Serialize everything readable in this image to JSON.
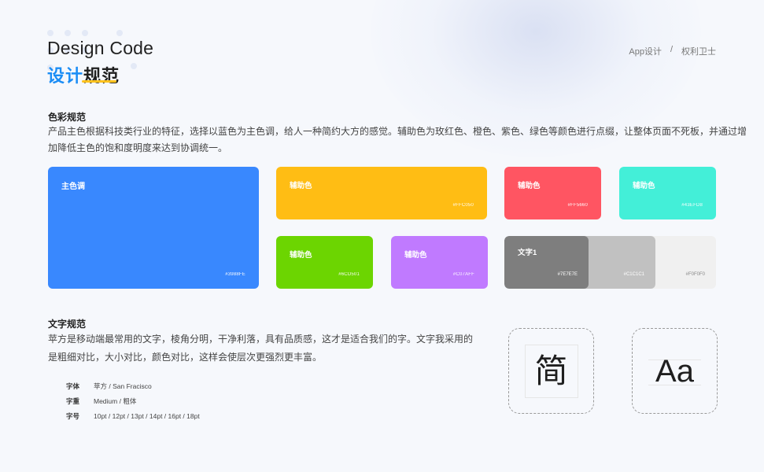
{
  "header": {
    "title": "Design Code",
    "subtitle_blue": "设计",
    "subtitle_dark": "规范",
    "breadcrumb": {
      "item1": "App设计",
      "sep": "/",
      "item2": "权利卫士"
    }
  },
  "color_section": {
    "title": "色彩规范",
    "desc_line1": "产品主色根据科技类行业的特征，选择以蓝色为主色调，给人一种简约大方的感觉。辅助色为玫红色、橙色、紫色、绿色等颜色进行点缀，让整体页面不死板，并通过增",
    "desc_line2": "加降低主色的饱和度明度来达到协调统一。",
    "swatches": [
      {
        "label": "主色调",
        "hex": "#3988FE",
        "color": "#3988FE"
      },
      {
        "label": "辅助色",
        "hex": "#FFC050",
        "color": "#FFBD14"
      },
      {
        "label": "辅助色",
        "hex": "#FF5660",
        "color": "#FF5562"
      },
      {
        "label": "辅助色",
        "hex": "#43EFD8",
        "color": "#43EFD8"
      },
      {
        "label": "辅助色",
        "hex": "#6CD501",
        "color": "#6CD501"
      },
      {
        "label": "辅助色",
        "hex": "#C07AFF",
        "color": "#C07AFF"
      }
    ],
    "text_colors": [
      {
        "label": "文字1",
        "hex": "#7E7E7E",
        "color": "#7E7E7E"
      },
      {
        "hex": "#C1C1C1",
        "color": "#C1C1C1"
      },
      {
        "hex": "#F0F0F0",
        "color": "#F0F0F0"
      }
    ]
  },
  "text_section": {
    "title": "文字规范",
    "desc_line1": "苹方是移动端最常用的文字，棱角分明，干净利落，具有品质感，这才是适合我们的字。文字我采用的",
    "desc_line2": "是粗细对比，大小对比，颜色对比，这样会使层次更强烈更丰富。",
    "specs": [
      {
        "key": "字体",
        "value": "苹方 / San Fracisco"
      },
      {
        "key": "字重",
        "value": "Medium / 粗体"
      },
      {
        "key": "字号",
        "value": "10pt / 12pt / 13pt / 14pt / 16pt / 18pt"
      }
    ],
    "glyph_cn": "简",
    "glyph_en": "Aa"
  }
}
